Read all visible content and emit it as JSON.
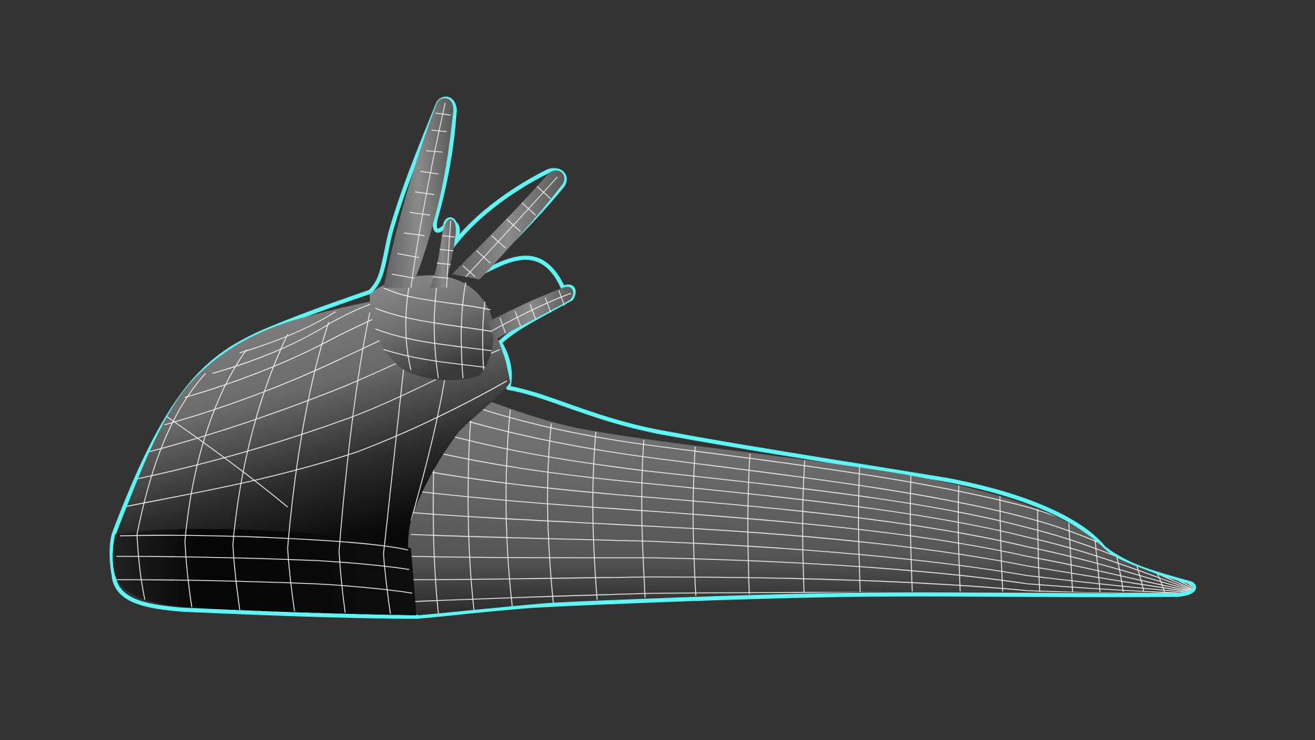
{
  "viewport": {
    "background_color": "#333333",
    "display_mode": "wireframe-on-shaded",
    "selected_object": "slug",
    "selection_outline_color": "#5FF5F5",
    "wire_color": "#EDEDED",
    "surface_light_color": "#767676",
    "surface_dark_color": "#050505"
  },
  "model": {
    "name": "slug",
    "icon": "slug-mesh-icon",
    "parts": [
      "body",
      "tail",
      "mantle",
      "head",
      "eye-stalk-upper",
      "eye-stalk-lower",
      "tentacle-upper",
      "tentacle-lower"
    ]
  }
}
